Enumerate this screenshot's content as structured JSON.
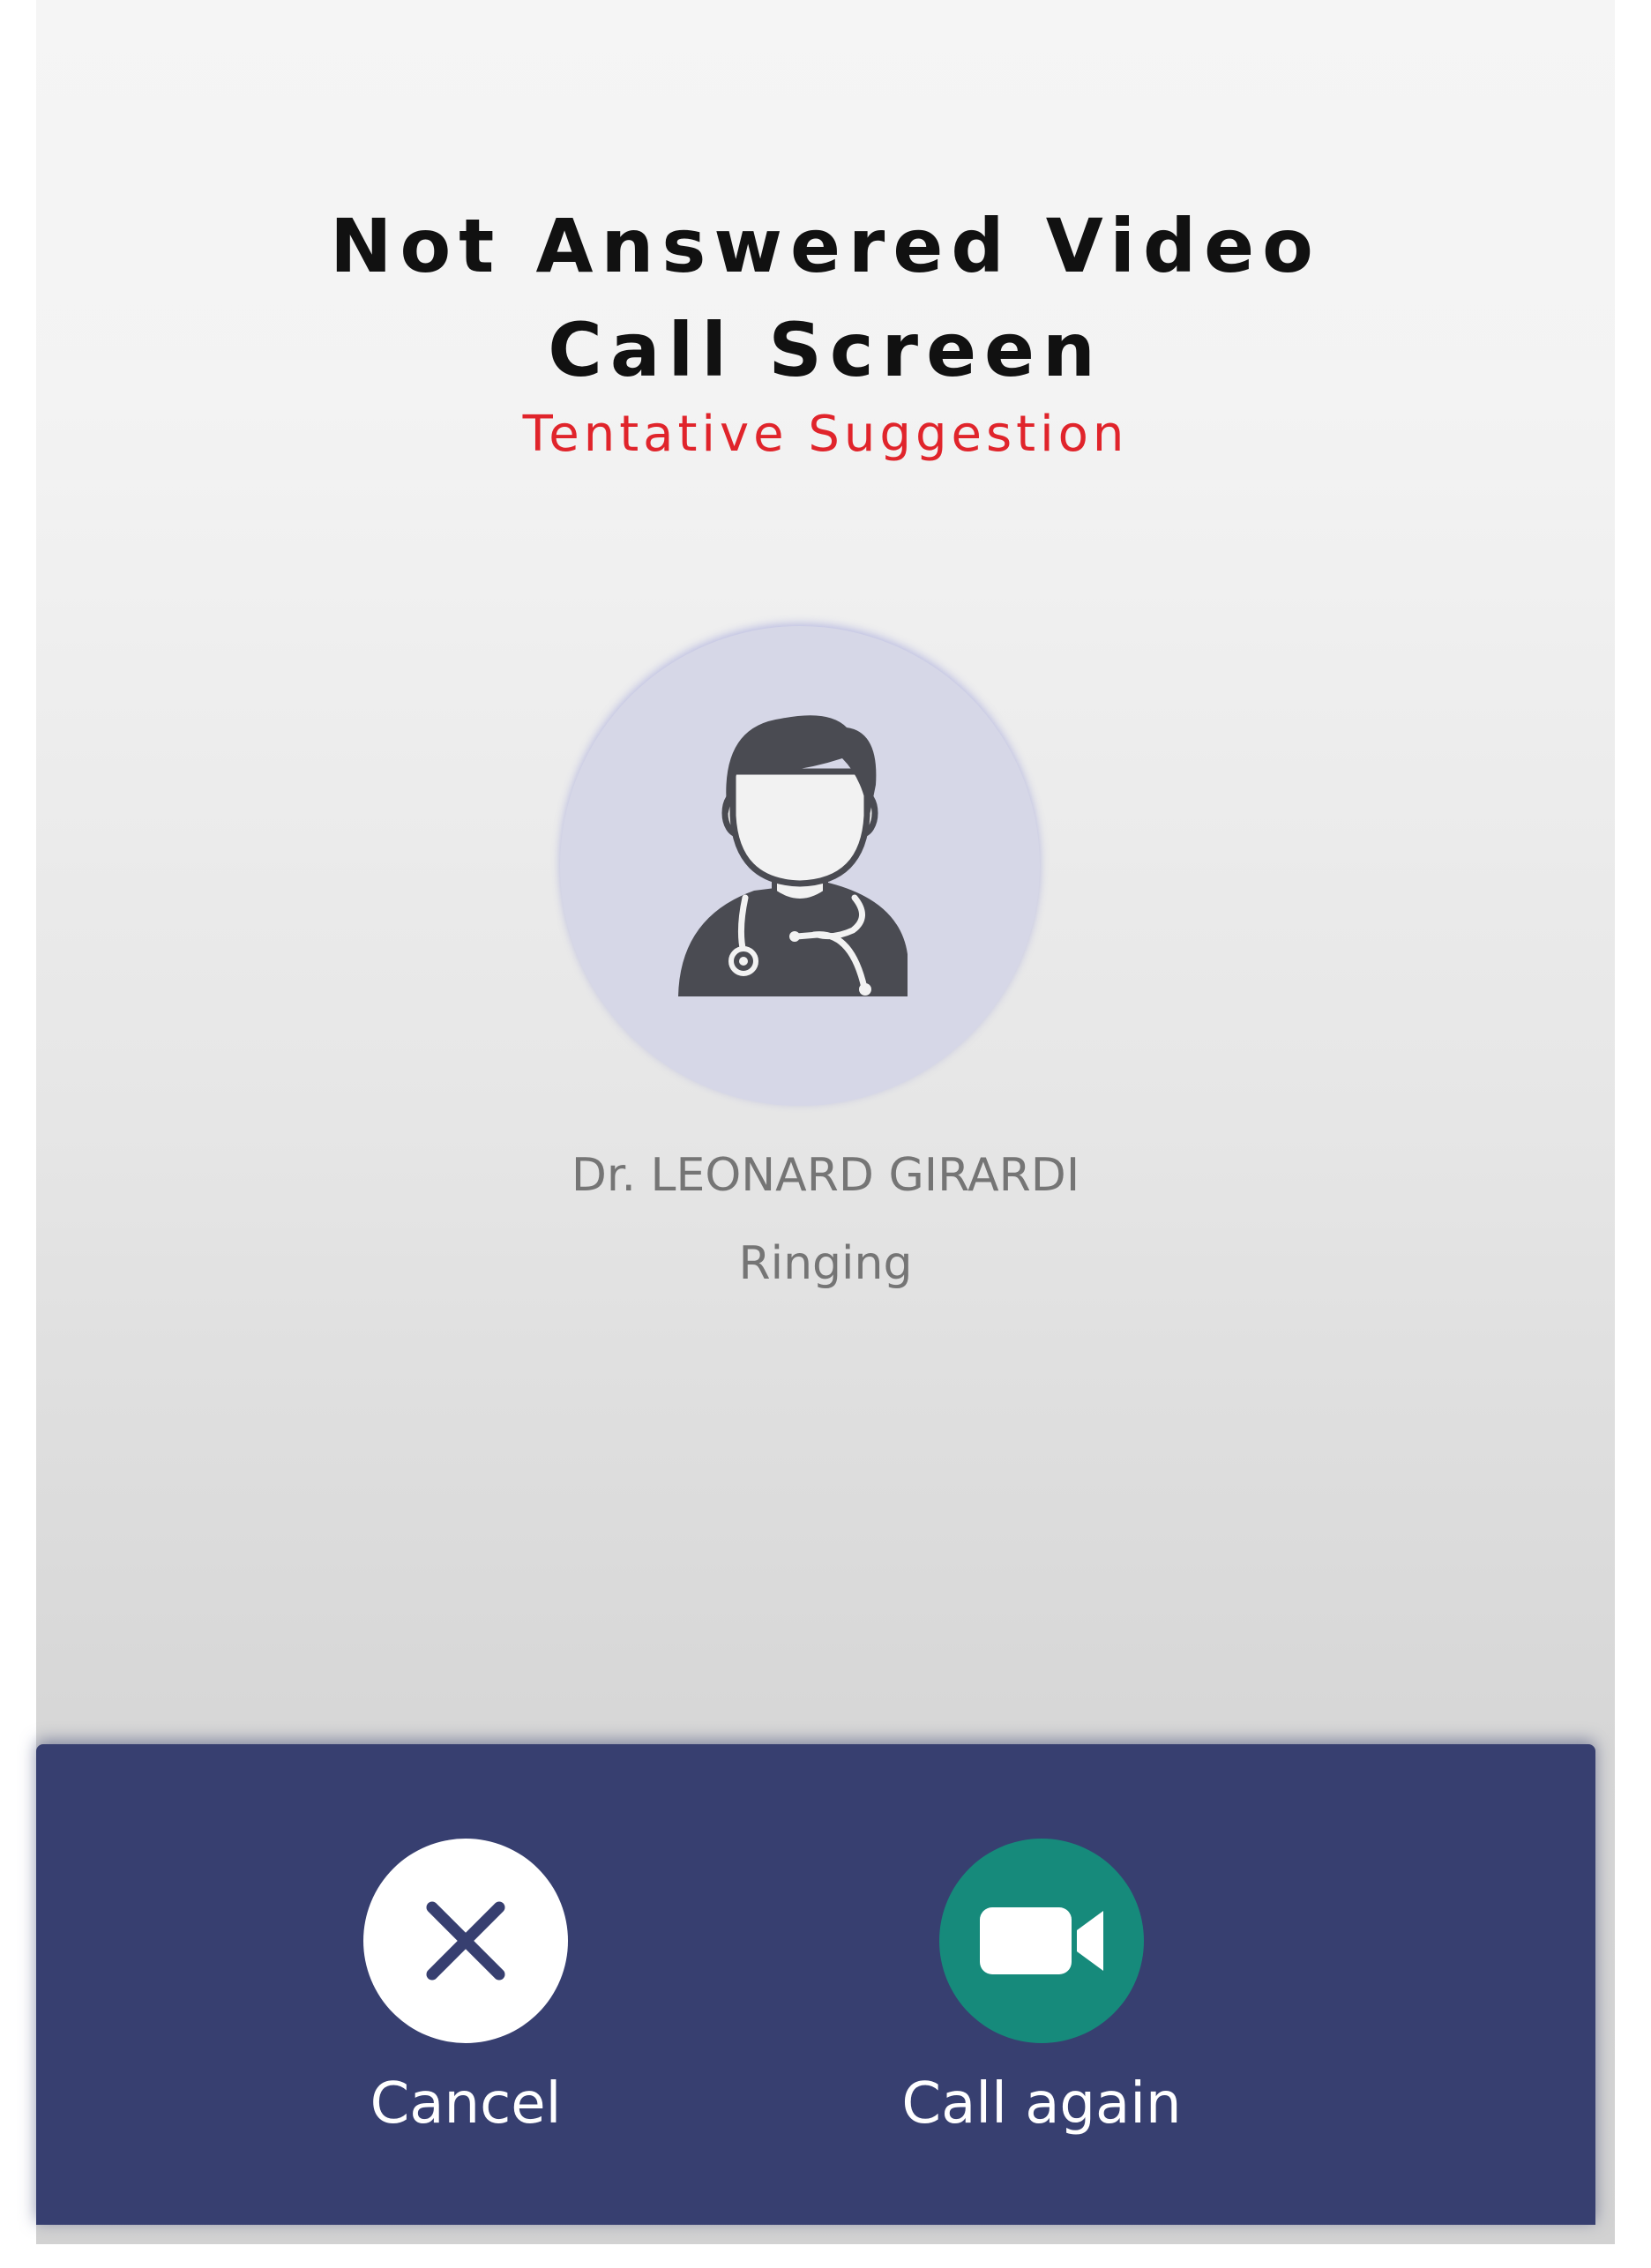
{
  "header": {
    "title_line1": "Not Answered Video",
    "title_line2": "Call Screen",
    "subtitle": "Tentative Suggestion"
  },
  "callee": {
    "avatar_icon": "doctor-avatar-icon",
    "name": "Dr. LEONARD GIRARDI",
    "status": "Ringing"
  },
  "actions": {
    "cancel": {
      "label": "Cancel",
      "icon": "close-icon"
    },
    "call_again": {
      "label": "Call again",
      "icon": "video-camera-icon"
    }
  },
  "colors": {
    "title": "#111111",
    "subtitle": "#e0242b",
    "avatar_bg": "#d6d7e7",
    "callee_text": "#757575",
    "action_bar": "#373f70",
    "call_again_button": "#168a7b",
    "cancel_button": "#ffffff"
  }
}
